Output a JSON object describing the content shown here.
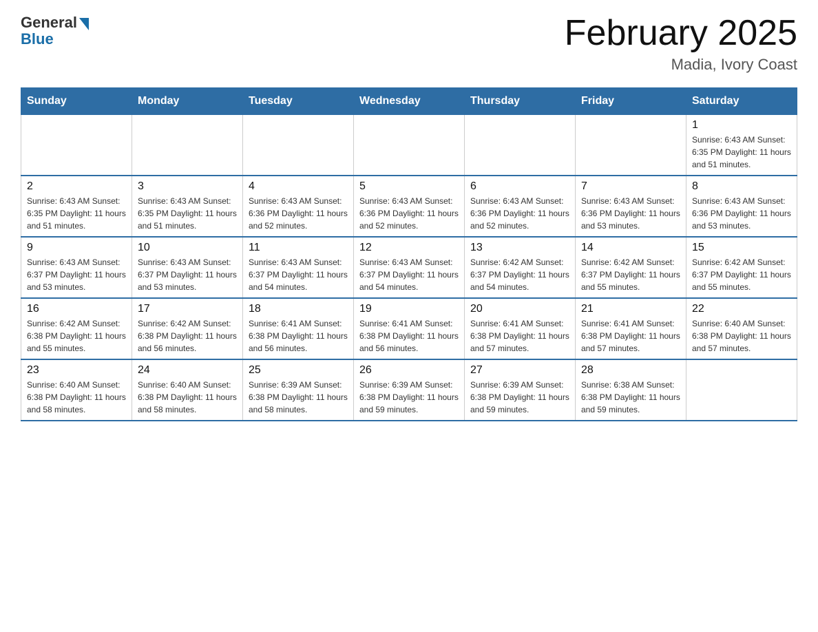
{
  "logo": {
    "general": "General",
    "blue": "Blue"
  },
  "title": "February 2025",
  "location": "Madia, Ivory Coast",
  "days_of_week": [
    "Sunday",
    "Monday",
    "Tuesday",
    "Wednesday",
    "Thursday",
    "Friday",
    "Saturday"
  ],
  "weeks": [
    [
      {
        "day": "",
        "info": ""
      },
      {
        "day": "",
        "info": ""
      },
      {
        "day": "",
        "info": ""
      },
      {
        "day": "",
        "info": ""
      },
      {
        "day": "",
        "info": ""
      },
      {
        "day": "",
        "info": ""
      },
      {
        "day": "1",
        "info": "Sunrise: 6:43 AM\nSunset: 6:35 PM\nDaylight: 11 hours\nand 51 minutes."
      }
    ],
    [
      {
        "day": "2",
        "info": "Sunrise: 6:43 AM\nSunset: 6:35 PM\nDaylight: 11 hours\nand 51 minutes."
      },
      {
        "day": "3",
        "info": "Sunrise: 6:43 AM\nSunset: 6:35 PM\nDaylight: 11 hours\nand 51 minutes."
      },
      {
        "day": "4",
        "info": "Sunrise: 6:43 AM\nSunset: 6:36 PM\nDaylight: 11 hours\nand 52 minutes."
      },
      {
        "day": "5",
        "info": "Sunrise: 6:43 AM\nSunset: 6:36 PM\nDaylight: 11 hours\nand 52 minutes."
      },
      {
        "day": "6",
        "info": "Sunrise: 6:43 AM\nSunset: 6:36 PM\nDaylight: 11 hours\nand 52 minutes."
      },
      {
        "day": "7",
        "info": "Sunrise: 6:43 AM\nSunset: 6:36 PM\nDaylight: 11 hours\nand 53 minutes."
      },
      {
        "day": "8",
        "info": "Sunrise: 6:43 AM\nSunset: 6:36 PM\nDaylight: 11 hours\nand 53 minutes."
      }
    ],
    [
      {
        "day": "9",
        "info": "Sunrise: 6:43 AM\nSunset: 6:37 PM\nDaylight: 11 hours\nand 53 minutes."
      },
      {
        "day": "10",
        "info": "Sunrise: 6:43 AM\nSunset: 6:37 PM\nDaylight: 11 hours\nand 53 minutes."
      },
      {
        "day": "11",
        "info": "Sunrise: 6:43 AM\nSunset: 6:37 PM\nDaylight: 11 hours\nand 54 minutes."
      },
      {
        "day": "12",
        "info": "Sunrise: 6:43 AM\nSunset: 6:37 PM\nDaylight: 11 hours\nand 54 minutes."
      },
      {
        "day": "13",
        "info": "Sunrise: 6:42 AM\nSunset: 6:37 PM\nDaylight: 11 hours\nand 54 minutes."
      },
      {
        "day": "14",
        "info": "Sunrise: 6:42 AM\nSunset: 6:37 PM\nDaylight: 11 hours\nand 55 minutes."
      },
      {
        "day": "15",
        "info": "Sunrise: 6:42 AM\nSunset: 6:37 PM\nDaylight: 11 hours\nand 55 minutes."
      }
    ],
    [
      {
        "day": "16",
        "info": "Sunrise: 6:42 AM\nSunset: 6:38 PM\nDaylight: 11 hours\nand 55 minutes."
      },
      {
        "day": "17",
        "info": "Sunrise: 6:42 AM\nSunset: 6:38 PM\nDaylight: 11 hours\nand 56 minutes."
      },
      {
        "day": "18",
        "info": "Sunrise: 6:41 AM\nSunset: 6:38 PM\nDaylight: 11 hours\nand 56 minutes."
      },
      {
        "day": "19",
        "info": "Sunrise: 6:41 AM\nSunset: 6:38 PM\nDaylight: 11 hours\nand 56 minutes."
      },
      {
        "day": "20",
        "info": "Sunrise: 6:41 AM\nSunset: 6:38 PM\nDaylight: 11 hours\nand 57 minutes."
      },
      {
        "day": "21",
        "info": "Sunrise: 6:41 AM\nSunset: 6:38 PM\nDaylight: 11 hours\nand 57 minutes."
      },
      {
        "day": "22",
        "info": "Sunrise: 6:40 AM\nSunset: 6:38 PM\nDaylight: 11 hours\nand 57 minutes."
      }
    ],
    [
      {
        "day": "23",
        "info": "Sunrise: 6:40 AM\nSunset: 6:38 PM\nDaylight: 11 hours\nand 58 minutes."
      },
      {
        "day": "24",
        "info": "Sunrise: 6:40 AM\nSunset: 6:38 PM\nDaylight: 11 hours\nand 58 minutes."
      },
      {
        "day": "25",
        "info": "Sunrise: 6:39 AM\nSunset: 6:38 PM\nDaylight: 11 hours\nand 58 minutes."
      },
      {
        "day": "26",
        "info": "Sunrise: 6:39 AM\nSunset: 6:38 PM\nDaylight: 11 hours\nand 59 minutes."
      },
      {
        "day": "27",
        "info": "Sunrise: 6:39 AM\nSunset: 6:38 PM\nDaylight: 11 hours\nand 59 minutes."
      },
      {
        "day": "28",
        "info": "Sunrise: 6:38 AM\nSunset: 6:38 PM\nDaylight: 11 hours\nand 59 minutes."
      },
      {
        "day": "",
        "info": ""
      }
    ]
  ]
}
